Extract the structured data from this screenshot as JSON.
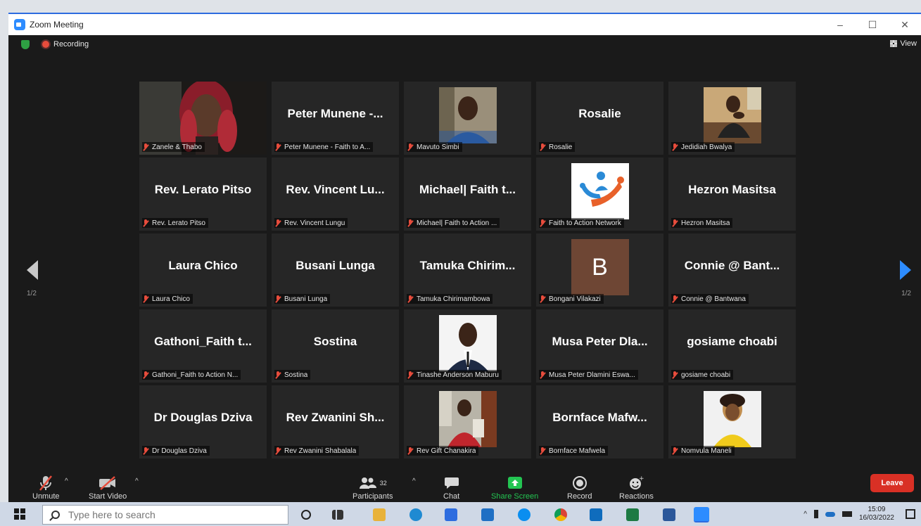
{
  "window": {
    "title": "Zoom Meeting",
    "minimize": "–",
    "maximize": "☐",
    "close": "✕"
  },
  "status": {
    "recording": "Recording",
    "view": "View"
  },
  "pages": {
    "left": "1/2",
    "right": "1/2"
  },
  "participants": [
    {
      "big": "",
      "caption": "Zanele & Thabo",
      "photo": "full-woman"
    },
    {
      "big": "Peter Munene -...",
      "caption": "Peter Munene - Faith to A..."
    },
    {
      "big": "",
      "caption": "Mavuto Simbi",
      "photo": "man-blue"
    },
    {
      "big": "Rosalie",
      "caption": "Rosalie"
    },
    {
      "big": "",
      "caption": "Jedidiah Bwalya",
      "photo": "man-sofa"
    },
    {
      "big": "Rev. Lerato Pitso",
      "caption": "Rev. Lerato Pitso"
    },
    {
      "big": "Rev. Vincent Lu...",
      "caption": "Rev. Vincent Lungu"
    },
    {
      "big": "Michael| Faith t...",
      "caption": "Michael| Faith to Action ..."
    },
    {
      "big": "",
      "caption": "Faith to Action Network",
      "photo": "logo"
    },
    {
      "big": "Hezron Masitsa",
      "caption": "Hezron Masitsa"
    },
    {
      "big": "Laura Chico",
      "caption": "Laura Chico"
    },
    {
      "big": "Busani Lunga",
      "caption": "Busani Lunga"
    },
    {
      "big": "Tamuka Chirim...",
      "caption": "Tamuka Chirimambowa"
    },
    {
      "big": "",
      "caption": "Bongani Vilakazi",
      "letter": "B"
    },
    {
      "big": "Connie @ Bant...",
      "caption": "Connie @ Bantwana"
    },
    {
      "big": "Gathoni_Faith t...",
      "caption": "Gathoni_Faith to Action N..."
    },
    {
      "big": "Sostina",
      "caption": "Sostina"
    },
    {
      "big": "",
      "caption": "Tinashe Anderson Maburu",
      "photo": "man-suit"
    },
    {
      "big": "Musa Peter Dla...",
      "caption": "Musa Peter Dlamini Eswa..."
    },
    {
      "big": "gosiame choabi",
      "caption": "gosiame choabi"
    },
    {
      "big": "Dr Douglas Dziva",
      "caption": "Dr Douglas Dziva"
    },
    {
      "big": "Rev Zwanini Sh...",
      "caption": "Rev Zwanini Shabalala"
    },
    {
      "big": "",
      "caption": "Rev Gift Chanakira",
      "photo": "man-red"
    },
    {
      "big": "Bornface Mafw...",
      "caption": "Bornface Mafwela"
    },
    {
      "big": "",
      "caption": "Nomvula Maneli",
      "photo": "woman-yellow"
    }
  ],
  "toolbar": {
    "unmute": "Unmute",
    "start_video": "Start Video",
    "participants": "Participants",
    "participants_count": "32",
    "chat": "Chat",
    "share_screen": "Share Screen",
    "record": "Record",
    "reactions": "Reactions",
    "leave": "Leave"
  },
  "taskbar": {
    "search_placeholder": "Type here to search",
    "time": "15:09",
    "date": "16/03/2022"
  },
  "colors": {
    "active_speaker": "#c8d64b",
    "share_green": "#23c552",
    "leave_red": "#d93025",
    "accent_blue": "#2d8cff"
  }
}
